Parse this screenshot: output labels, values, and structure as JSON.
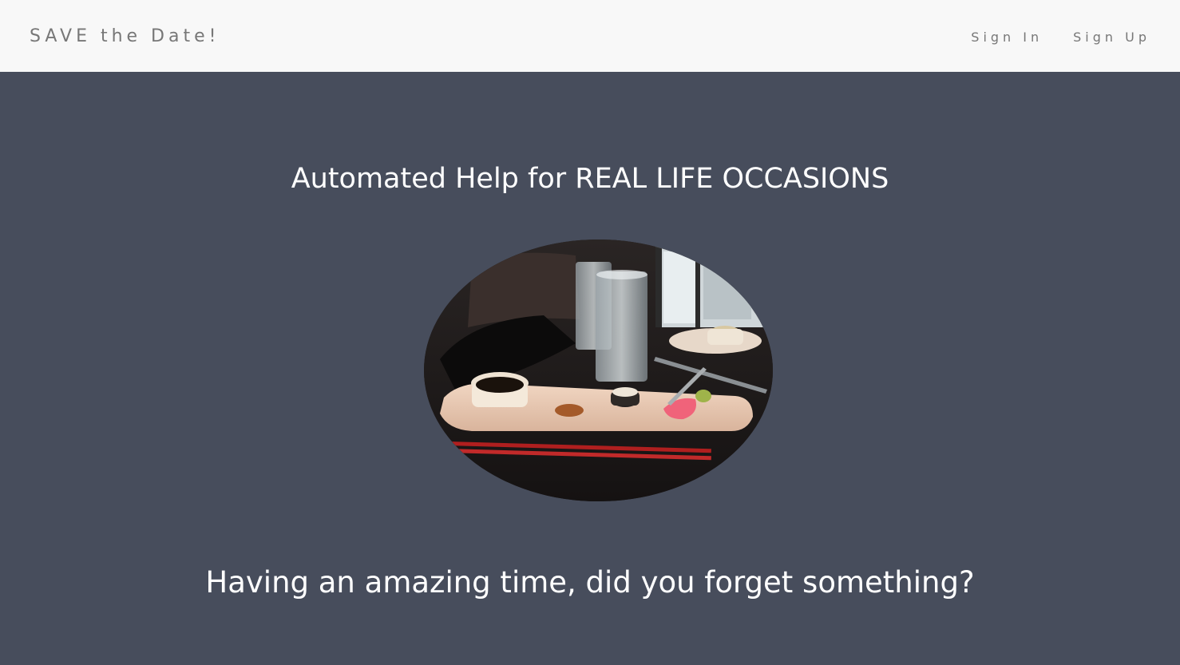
{
  "navbar": {
    "brand": "SAVE the Date!",
    "links": [
      {
        "label": "Sign In"
      },
      {
        "label": "Sign Up"
      }
    ]
  },
  "hero": {
    "headline": "Automated Help for REAL LIFE OCCASIONS",
    "tagline": "Having an amazing time, did you forget something?",
    "photo_subject": "restaurant table with sushi plate, water glasses and red chopsticks"
  },
  "colors": {
    "navbar_bg": "#f8f8f8",
    "hero_bg": "#474d5c",
    "nav_text": "#777777",
    "hero_text": "#ffffff"
  }
}
